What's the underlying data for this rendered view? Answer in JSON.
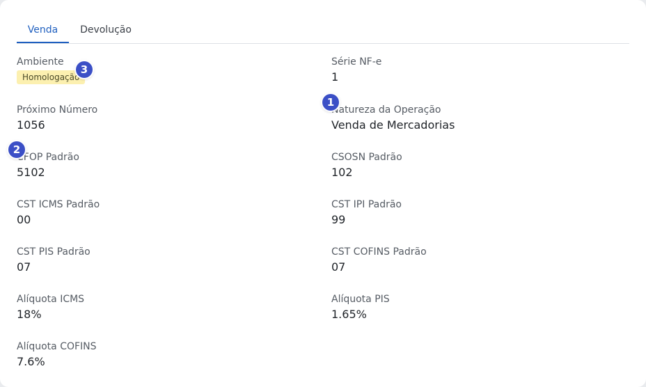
{
  "tabs": [
    {
      "label": "Venda",
      "active": true
    },
    {
      "label": "Devolução",
      "active": false
    }
  ],
  "fields": {
    "ambiente": {
      "label": "Ambiente",
      "value": "Homologação"
    },
    "serie": {
      "label": "Série NF-e",
      "value": "1"
    },
    "proximo_numero": {
      "label": "Próximo Número",
      "value": "1056"
    },
    "natureza": {
      "label": "Natureza da Operação",
      "value": "Venda de Mercadorias"
    },
    "cfop": {
      "label": "CFOP Padrão",
      "value": "5102"
    },
    "csosn": {
      "label": "CSOSN Padrão",
      "value": "102"
    },
    "cst_icms": {
      "label": "CST ICMS Padrão",
      "value": "00"
    },
    "cst_ipi": {
      "label": "CST IPI Padrão",
      "value": "99"
    },
    "cst_pis": {
      "label": "CST PIS Padrão",
      "value": "07"
    },
    "cst_cofins": {
      "label": "CST COFINS Padrão",
      "value": "07"
    },
    "aliquota_icms": {
      "label": "Alíquota ICMS",
      "value": "18%"
    },
    "aliquota_pis": {
      "label": "Alíquota PIS",
      "value": "1.65%"
    },
    "aliquota_cofins": {
      "label": "Alíquota COFINS",
      "value": "7.6%"
    }
  },
  "markers": [
    "1",
    "2",
    "3"
  ],
  "colors": {
    "accent": "#1f5fbf",
    "badge_bg": "#fcf0b0",
    "marker": "#3b4fc6"
  }
}
